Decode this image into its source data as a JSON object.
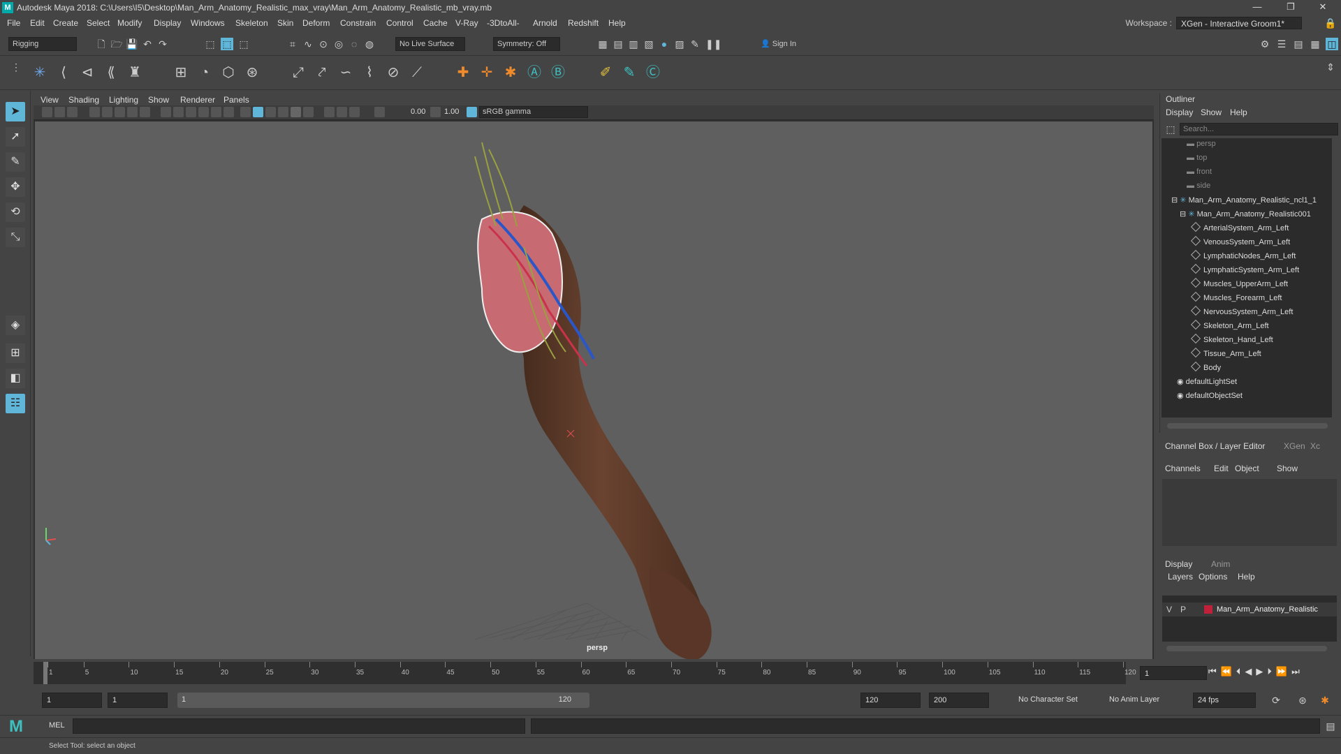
{
  "title": "Autodesk Maya 2018: C:\\Users\\I5\\Desktop\\Man_Arm_Anatomy_Realistic_max_vray\\Man_Arm_Anatomy_Realistic_mb_vray.mb",
  "window_controls": {
    "minimize": "—",
    "maximize": "❐",
    "close": "✕"
  },
  "menu": [
    "File",
    "Edit",
    "Create",
    "Select",
    "Modify",
    "Display",
    "Windows",
    "Skeleton",
    "Skin",
    "Deform",
    "Constrain",
    "Control",
    "Cache",
    "V-Ray",
    "-3DtoAll-",
    "Arnold",
    "Redshift",
    "Help"
  ],
  "workspace": {
    "label": "Workspace :",
    "value": "XGen - Interactive Groom1*"
  },
  "statusline": {
    "menuset": "Rigging",
    "live_surface": "No Live Surface",
    "symmetry": "Symmetry: Off",
    "sign_in": "Sign In"
  },
  "panel_menu": [
    "View",
    "Shading",
    "Lighting",
    "Show",
    "Renderer",
    "Panels"
  ],
  "panel_toolbar": {
    "exposure": "0.00",
    "gamma": "1.00",
    "colorspace": "sRGB gamma"
  },
  "viewport": {
    "camera_label": "persp"
  },
  "outliner": {
    "title": "Outliner",
    "menu": [
      "Display",
      "Show",
      "Help"
    ],
    "search_placeholder": "Search...",
    "items": [
      {
        "label": "persp",
        "type": "camera"
      },
      {
        "label": "top",
        "type": "camera"
      },
      {
        "label": "front",
        "type": "camera"
      },
      {
        "label": "side",
        "type": "camera"
      },
      {
        "label": "Man_Arm_Anatomy_Realistic_ncl1_1",
        "type": "group"
      },
      {
        "label": "Man_Arm_Anatomy_Realistic001",
        "type": "group"
      },
      {
        "label": "ArterialSystem_Arm_Left",
        "type": "mesh"
      },
      {
        "label": "VenousSystem_Arm_Left",
        "type": "mesh"
      },
      {
        "label": "LymphaticNodes_Arm_Left",
        "type": "mesh"
      },
      {
        "label": "LymphaticSystem_Arm_Left",
        "type": "mesh"
      },
      {
        "label": "Muscles_UpperArm_Left",
        "type": "mesh"
      },
      {
        "label": "Muscles_Forearm_Left",
        "type": "mesh"
      },
      {
        "label": "NervousSystem_Arm_Left",
        "type": "mesh"
      },
      {
        "label": "Skeleton_Arm_Left",
        "type": "mesh"
      },
      {
        "label": "Skeleton_Hand_Left",
        "type": "mesh"
      },
      {
        "label": "Tissue_Arm_Left",
        "type": "mesh"
      },
      {
        "label": "Body",
        "type": "mesh"
      },
      {
        "label": "defaultLightSet",
        "type": "set"
      },
      {
        "label": "defaultObjectSet",
        "type": "set"
      }
    ]
  },
  "channel_box": {
    "tabs": [
      "Channel Box / Layer Editor",
      "XGen",
      "Xc"
    ],
    "menu": [
      "Channels",
      "Edit",
      "Object",
      "Show"
    ]
  },
  "layer_editor": {
    "tabs": [
      "Display",
      "Anim"
    ],
    "menu": [
      "Layers",
      "Options",
      "Help"
    ],
    "layer": {
      "v": "V",
      "p": "P",
      "name": "Man_Arm_Anatomy_Realistic",
      "color": "#c0203a"
    }
  },
  "timeline": {
    "ticks": [
      1,
      5,
      10,
      15,
      20,
      25,
      30,
      35,
      40,
      45,
      50,
      55,
      60,
      65,
      70,
      75,
      80,
      85,
      90,
      95,
      100,
      105,
      110,
      115,
      120
    ],
    "current_frame": "1"
  },
  "range": {
    "start": "1",
    "playback_start": "1",
    "slider_start": "1",
    "slider_end": "120",
    "playback_end": "120",
    "end": "200",
    "character_set": "No Character Set",
    "anim_layer": "No Anim Layer",
    "fps": "24 fps"
  },
  "command_line": {
    "label": "MEL"
  },
  "help_line": "Select Tool: select an object",
  "colors": {
    "accent": "#5fb6d9",
    "layer_red": "#c0203a",
    "viewport_bg": "#5f5f5f"
  }
}
